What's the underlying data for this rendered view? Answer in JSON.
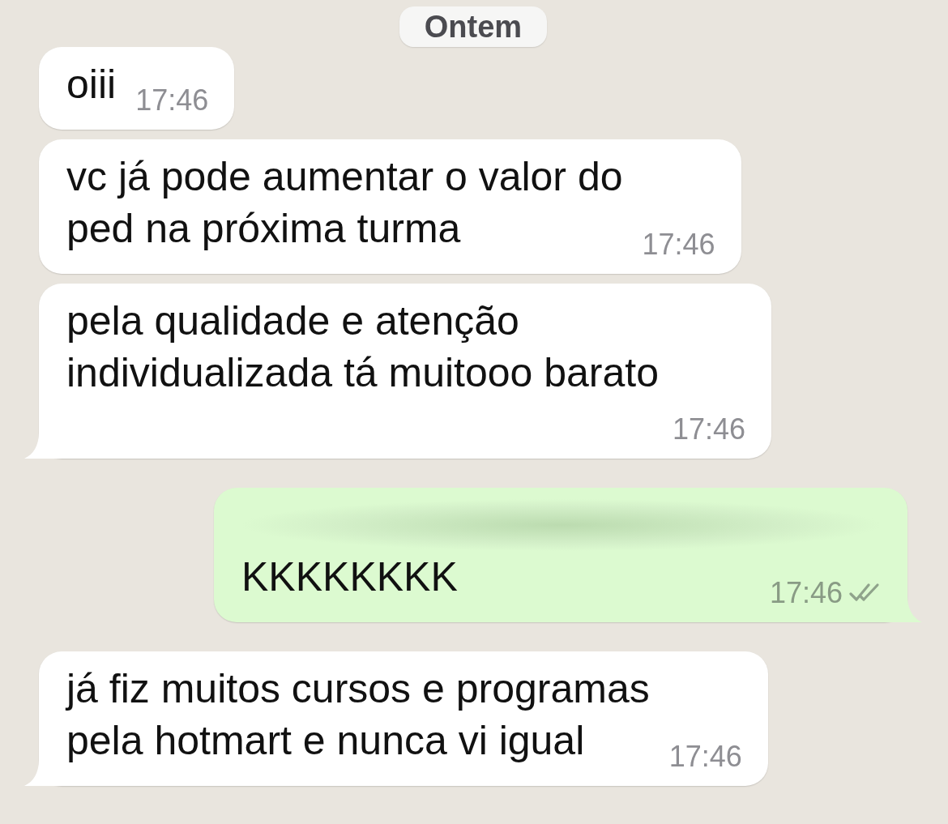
{
  "date_chip": {
    "label": "Ontem"
  },
  "messages": [
    {
      "kind": "incoming",
      "text": "oiii",
      "time": "17:46",
      "tail": false
    },
    {
      "kind": "incoming",
      "text": "vc já pode aumentar o valor do\nped na próxima turma",
      "time": "17:46",
      "tail": false
    },
    {
      "kind": "incoming",
      "text": "pela qualidade e atenção\nindividualizada tá muitooo barato",
      "time": "17:46",
      "tail": true
    },
    {
      "kind": "outgoing",
      "redacted": true,
      "text": "KKKKKKKK",
      "time": "17:46",
      "delivered": true,
      "read": false,
      "tail": true
    },
    {
      "kind": "incoming",
      "text": "já fiz muitos cursos e programas\npela hotmart e nunca vi igual",
      "time": "17:46",
      "tail": true
    }
  ]
}
